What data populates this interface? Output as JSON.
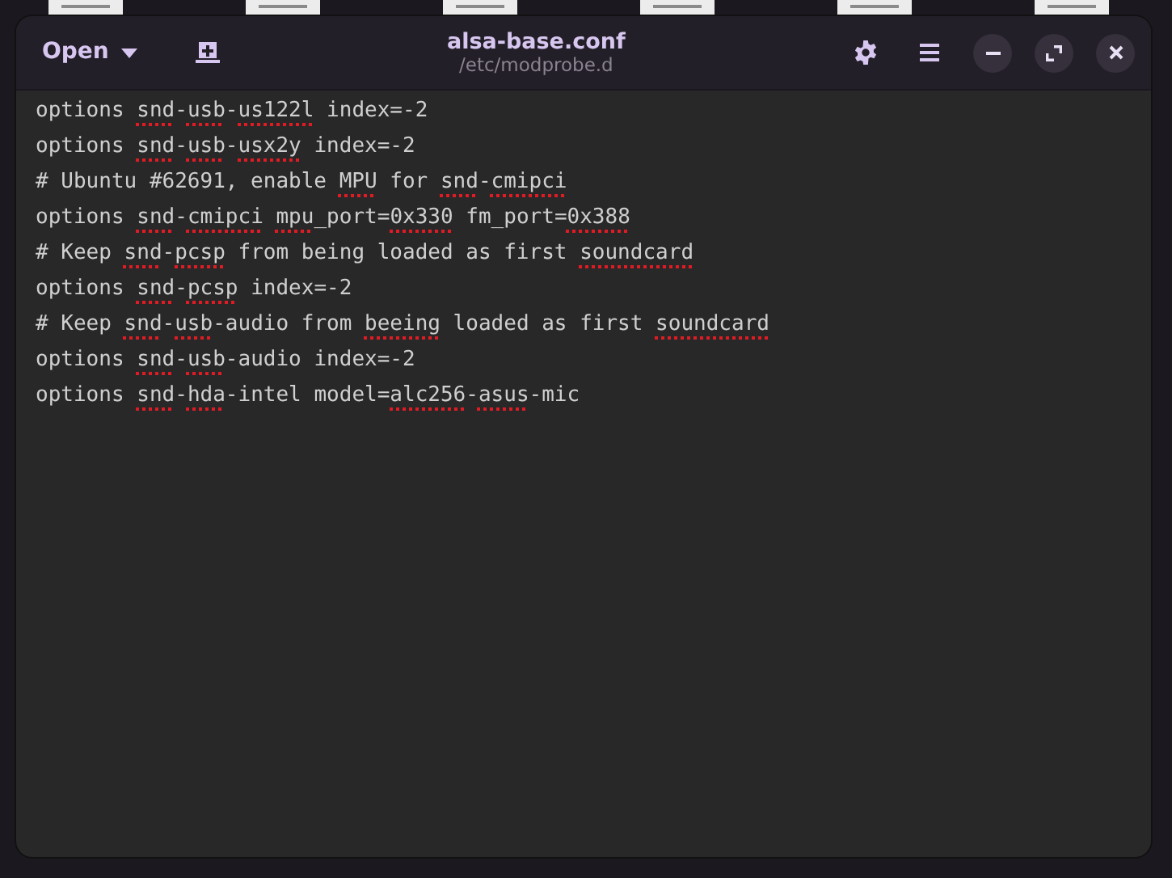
{
  "window": {
    "title": "alsa-base.conf",
    "subtitle": "/etc/modprobe.d"
  },
  "header": {
    "open_label": "Open"
  },
  "lines": [
    {
      "tokens": [
        {
          "text": "options ",
          "misspelled": false
        },
        {
          "text": "snd",
          "misspelled": true
        },
        {
          "text": "-",
          "misspelled": false
        },
        {
          "text": "usb",
          "misspelled": true
        },
        {
          "text": "-",
          "misspelled": false
        },
        {
          "text": "us122l",
          "misspelled": true
        },
        {
          "text": " index=-2",
          "misspelled": false
        }
      ]
    },
    {
      "tokens": [
        {
          "text": "options ",
          "misspelled": false
        },
        {
          "text": "snd",
          "misspelled": true
        },
        {
          "text": "-",
          "misspelled": false
        },
        {
          "text": "usb",
          "misspelled": true
        },
        {
          "text": "-",
          "misspelled": false
        },
        {
          "text": "usx2y",
          "misspelled": true
        },
        {
          "text": " index=-2",
          "misspelled": false
        }
      ]
    },
    {
      "tokens": [
        {
          "text": "# Ubuntu #62691, enable ",
          "misspelled": false
        },
        {
          "text": "MPU",
          "misspelled": true
        },
        {
          "text": " for ",
          "misspelled": false
        },
        {
          "text": "snd",
          "misspelled": true
        },
        {
          "text": "-",
          "misspelled": false
        },
        {
          "text": "cmipci",
          "misspelled": true
        }
      ]
    },
    {
      "tokens": [
        {
          "text": "options ",
          "misspelled": false
        },
        {
          "text": "snd",
          "misspelled": true
        },
        {
          "text": "-",
          "misspelled": false
        },
        {
          "text": "cmipci",
          "misspelled": true
        },
        {
          "text": "mpu",
          "misspelled": true,
          "space_before": true
        },
        {
          "text": "_port=",
          "misspelled": false
        },
        {
          "text": "0x330",
          "misspelled": true
        },
        {
          "text": " fm_port=",
          "misspelled": false
        },
        {
          "text": "0x388",
          "misspelled": true
        }
      ]
    },
    {
      "tokens": [
        {
          "text": "# Keep ",
          "misspelled": false
        },
        {
          "text": "snd",
          "misspelled": true
        },
        {
          "text": "-",
          "misspelled": false
        },
        {
          "text": "pcsp",
          "misspelled": true
        },
        {
          "text": " from being loaded as first ",
          "misspelled": false
        },
        {
          "text": "soundcard",
          "misspelled": true
        }
      ]
    },
    {
      "tokens": [
        {
          "text": "options ",
          "misspelled": false
        },
        {
          "text": "snd",
          "misspelled": true
        },
        {
          "text": "-",
          "misspelled": false
        },
        {
          "text": "pcsp",
          "misspelled": true
        },
        {
          "text": " index=-2",
          "misspelled": false
        }
      ]
    },
    {
      "tokens": [
        {
          "text": "# Keep ",
          "misspelled": false
        },
        {
          "text": "snd",
          "misspelled": true
        },
        {
          "text": "-",
          "misspelled": false
        },
        {
          "text": "usb",
          "misspelled": true
        },
        {
          "text": "-audio from ",
          "misspelled": false
        },
        {
          "text": "beeing",
          "misspelled": true
        },
        {
          "text": " loaded as first ",
          "misspelled": false
        },
        {
          "text": "soundcard",
          "misspelled": true
        }
      ]
    },
    {
      "tokens": [
        {
          "text": "options ",
          "misspelled": false
        },
        {
          "text": "snd",
          "misspelled": true
        },
        {
          "text": "-",
          "misspelled": false
        },
        {
          "text": "usb",
          "misspelled": true
        },
        {
          "text": "-audio index=-2",
          "misspelled": false
        }
      ]
    },
    {
      "tokens": [
        {
          "text": "options ",
          "misspelled": false
        },
        {
          "text": "snd",
          "misspelled": true
        },
        {
          "text": "-",
          "misspelled": false
        },
        {
          "text": "hda",
          "misspelled": true
        },
        {
          "text": "-intel model=",
          "misspelled": false
        },
        {
          "text": "alc256",
          "misspelled": true
        },
        {
          "text": "-",
          "misspelled": false
        },
        {
          "text": "asus",
          "misspelled": true
        },
        {
          "text": "-mic",
          "misspelled": false
        }
      ]
    }
  ]
}
